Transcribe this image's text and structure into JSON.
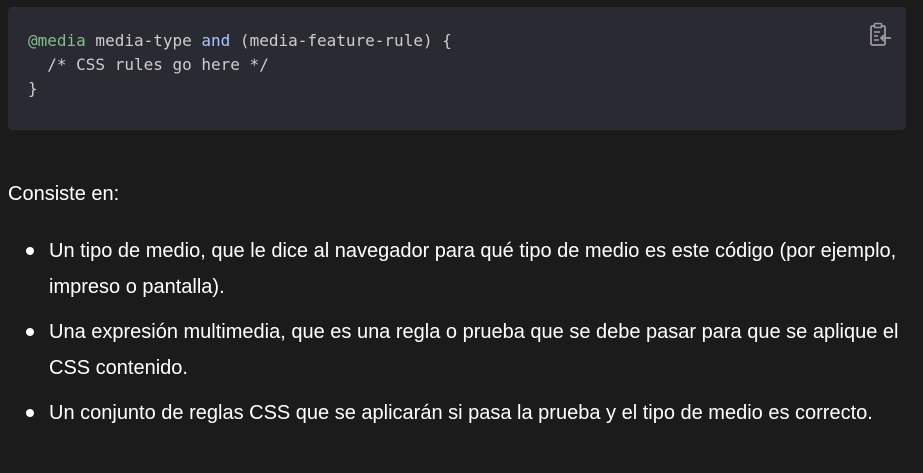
{
  "code_block": {
    "line1": {
      "at_rule": "@media",
      "media_type": " media-type ",
      "and_keyword": "and",
      "feature": " (media-feature-rule) {"
    },
    "line2": "  /* CSS rules go here */",
    "line3": "}",
    "copy_icon": "clipboard-copy-icon"
  },
  "intro_text": "Consiste en:",
  "bullets": [
    "Un tipo de medio, que le dice al navegador para qué tipo de medio es este código (por ejemplo, impreso o pantalla).",
    "Una expresión multimedia, que es una regla o prueba que se debe pasar para que se aplique el CSS contenido.",
    "Un conjunto de reglas CSS que se aplicarán si pasa la prueba y el tipo de medio es correcto."
  ],
  "colors": {
    "page_background": "#1b1b1b",
    "code_background": "#2a2a32",
    "at_rule": "#7fc08a",
    "keyword": "#a7c7ff",
    "code_text": "#cdcdcd",
    "body_text": "#ffffff"
  }
}
